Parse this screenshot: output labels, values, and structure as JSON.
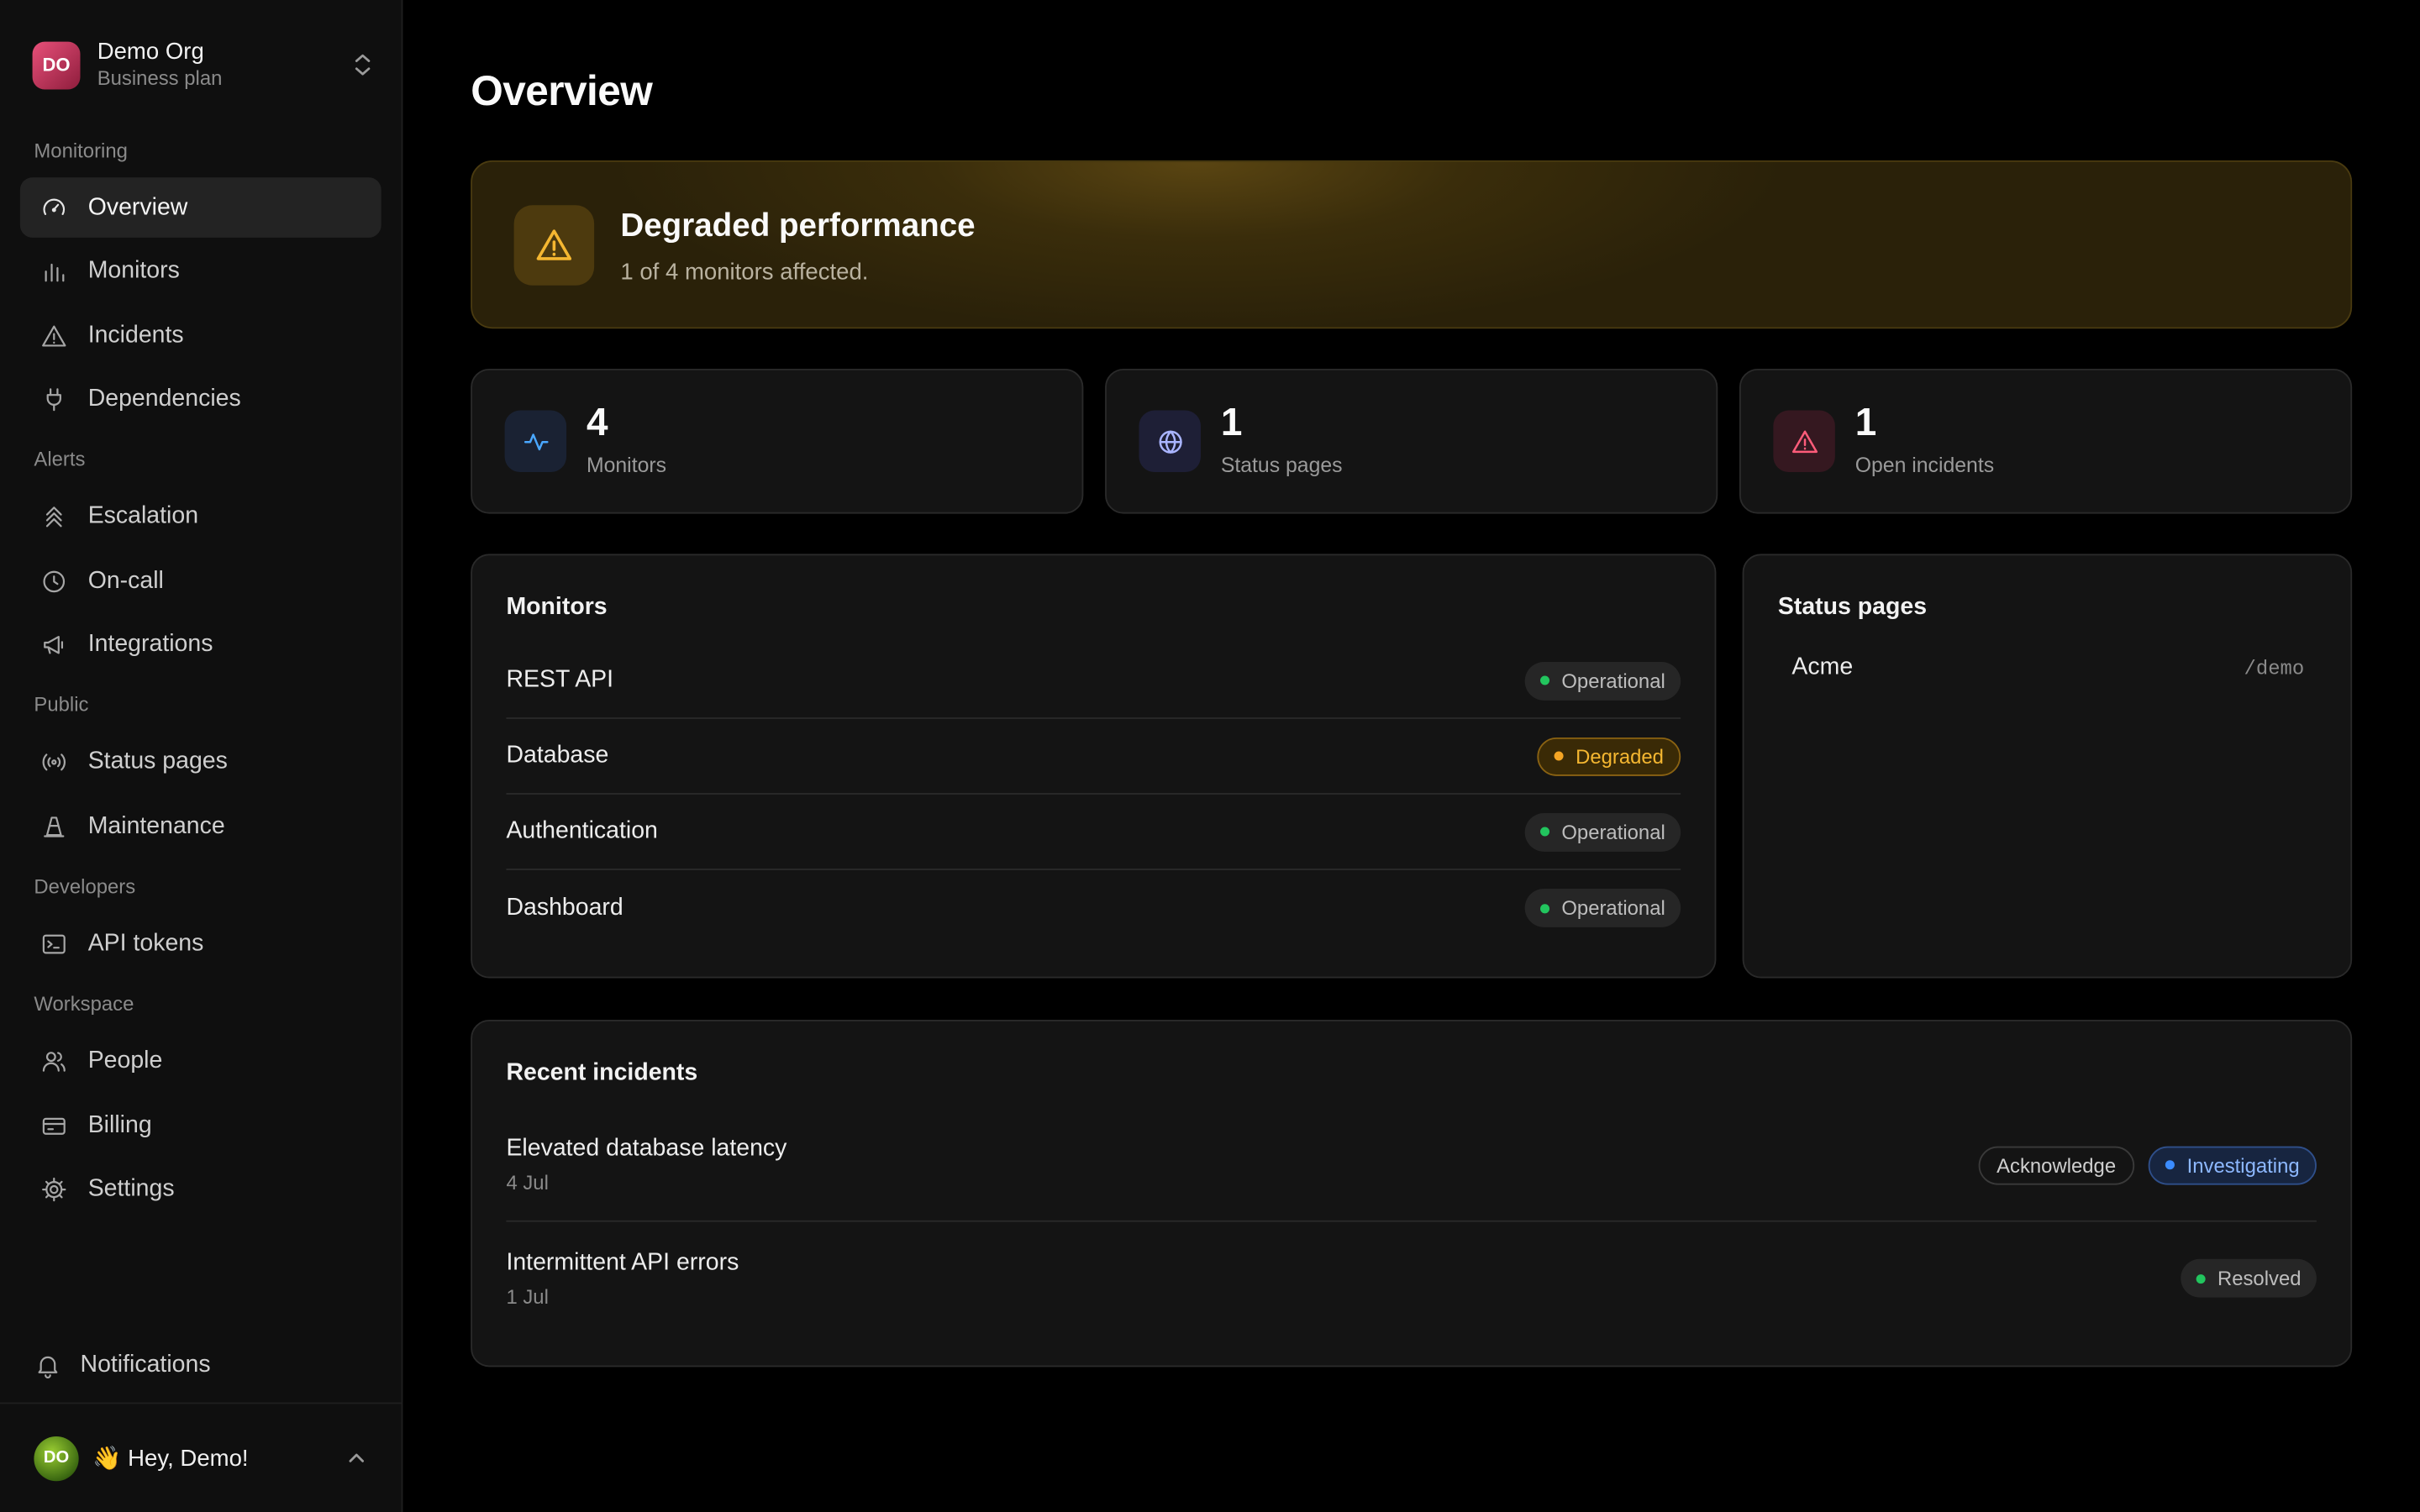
{
  "org": {
    "initials": "DO",
    "name": "Demo Org",
    "plan": "Business plan"
  },
  "sidebar": {
    "sections": [
      {
        "label": "Monitoring"
      },
      {
        "label": "Alerts"
      },
      {
        "label": "Public"
      },
      {
        "label": "Developers"
      },
      {
        "label": "Workspace"
      }
    ],
    "items": [
      {
        "label": "Overview",
        "icon": "gauge-icon"
      },
      {
        "label": "Monitors",
        "icon": "bar-chart-icon"
      },
      {
        "label": "Incidents",
        "icon": "warning-icon"
      },
      {
        "label": "Dependencies",
        "icon": "plug-icon"
      },
      {
        "label": "Escalation",
        "icon": "chevrons-up-icon"
      },
      {
        "label": "On-call",
        "icon": "clock-icon"
      },
      {
        "label": "Integrations",
        "icon": "megaphone-icon"
      },
      {
        "label": "Status pages",
        "icon": "broadcast-icon"
      },
      {
        "label": "Maintenance",
        "icon": "cone-icon"
      },
      {
        "label": "API tokens",
        "icon": "terminal-icon"
      },
      {
        "label": "People",
        "icon": "users-icon"
      },
      {
        "label": "Billing",
        "icon": "credit-card-icon"
      },
      {
        "label": "Settings",
        "icon": "gear-icon"
      }
    ],
    "active": "Overview",
    "notifications": "Notifications"
  },
  "user": {
    "initials": "DO",
    "greeting": "👋 Hey, Demo!"
  },
  "page": {
    "title": "Overview"
  },
  "banner": {
    "title": "Degraded performance",
    "subtitle": "1 of 4 monitors affected.",
    "color": "#f5b731"
  },
  "stats": [
    {
      "value": "4",
      "label": "Monitors",
      "icon": "activity-icon"
    },
    {
      "value": "1",
      "label": "Status pages",
      "icon": "globe-icon"
    },
    {
      "value": "1",
      "label": "Open incidents",
      "icon": "warning-icon"
    }
  ],
  "monitors": {
    "title": "Monitors",
    "rows": [
      {
        "name": "REST API",
        "status": "Operational"
      },
      {
        "name": "Database",
        "status": "Degraded"
      },
      {
        "name": "Authentication",
        "status": "Operational"
      },
      {
        "name": "Dashboard",
        "status": "Operational"
      }
    ]
  },
  "status_pages": {
    "title": "Status pages",
    "rows": [
      {
        "name": "Acme",
        "slug": "/demo"
      }
    ]
  },
  "incidents": {
    "title": "Recent incidents",
    "rows": [
      {
        "title": "Elevated database latency",
        "date": "4 Jul",
        "action": "Acknowledge",
        "status": "Investigating"
      },
      {
        "title": "Intermittent API errors",
        "date": "1 Jul",
        "status": "Resolved"
      }
    ]
  },
  "colors": {
    "operational": "#22c55e",
    "degraded": "#f5a524",
    "investigating": "#3b8cff",
    "accent_warning": "#f5b731"
  }
}
